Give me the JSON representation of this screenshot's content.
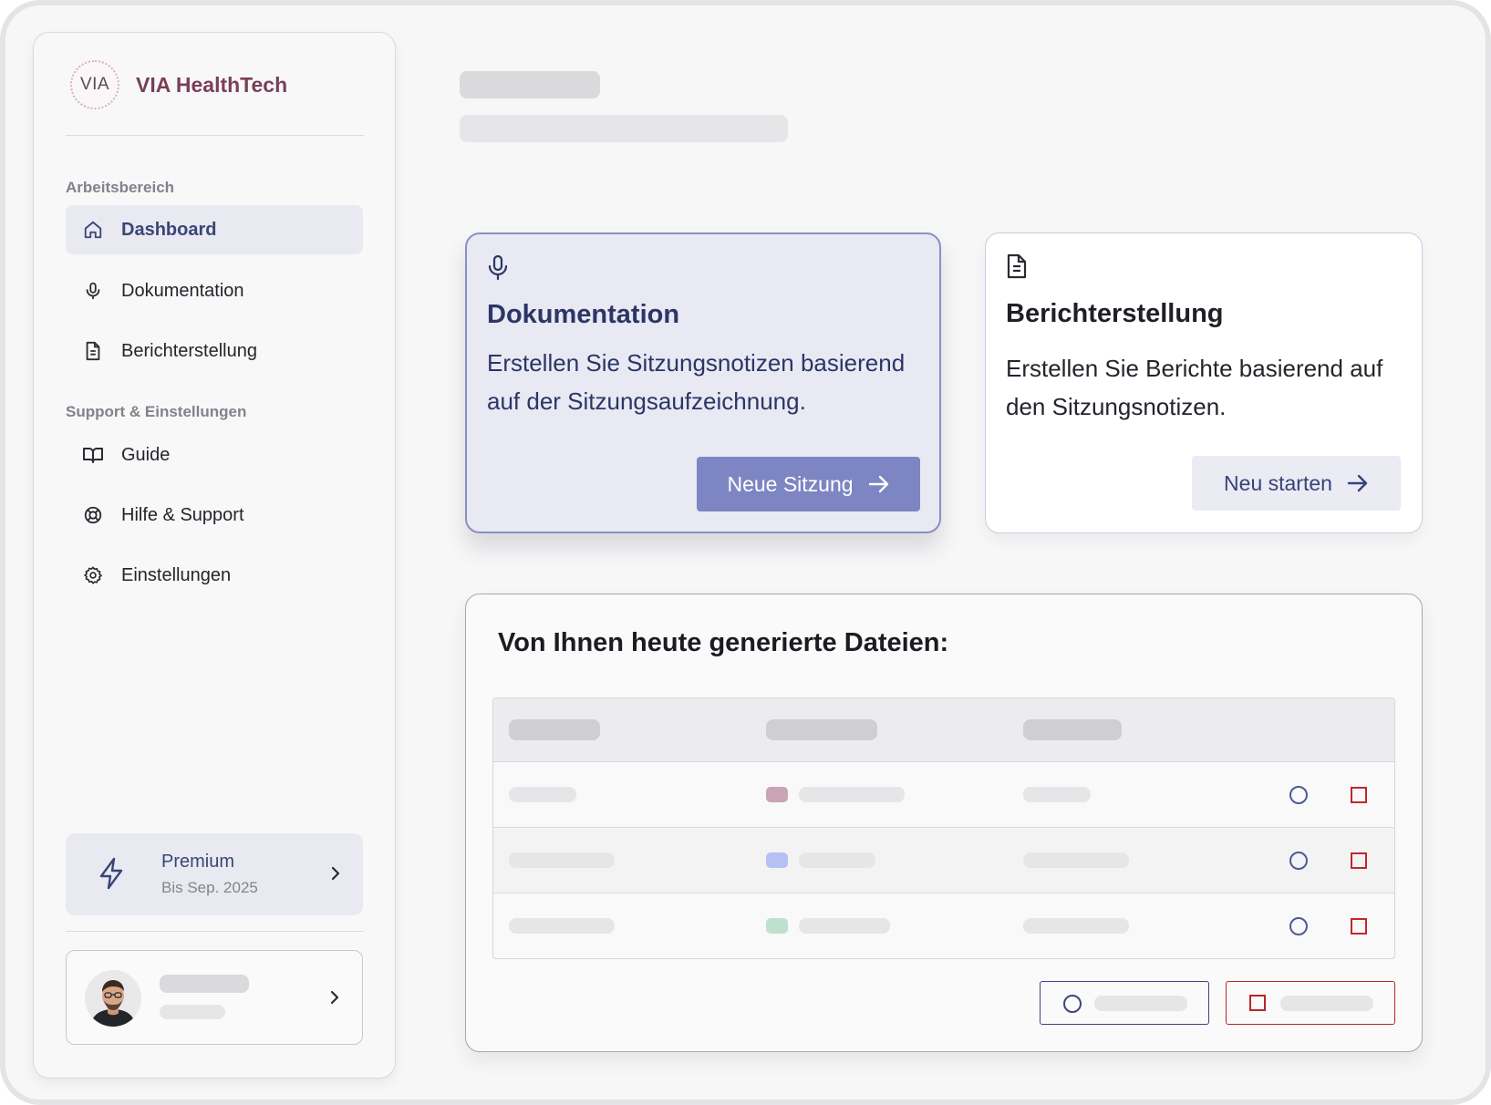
{
  "brand": {
    "logo_text": "VIA",
    "name": "VIA HealthTech"
  },
  "sidebar": {
    "section_workspace": "Arbeitsbereich",
    "section_support": "Support & Einstellungen",
    "items": [
      {
        "label": "Dashboard",
        "icon": "home-icon",
        "active": true
      },
      {
        "label": "Dokumentation",
        "icon": "microphone-icon",
        "active": false
      },
      {
        "label": "Berichterstellung",
        "icon": "document-icon",
        "active": false
      },
      {
        "label": "Guide",
        "icon": "book-icon",
        "active": false
      },
      {
        "label": "Hilfe & Support",
        "icon": "lifebuoy-icon",
        "active": false
      },
      {
        "label": "Einstellungen",
        "icon": "gear-icon",
        "active": false
      }
    ],
    "premium": {
      "title": "Premium",
      "subtitle": "Bis Sep. 2025",
      "icon": "lightning-icon"
    },
    "profile": {
      "icon": "avatar"
    }
  },
  "cards": {
    "documentation": {
      "title": "Dokumentation",
      "description": "Erstellen Sie Sitzungsnotizen basierend auf der Sitzungsaufzeichnung.",
      "button": "Neue Sitzung",
      "icon": "microphone-icon"
    },
    "reports": {
      "title": "Berichterstellung",
      "description": "Erstellen Sie Berichte basierend auf den Sitzungsnotizen.",
      "button": "Neu starten",
      "icon": "document-icon"
    }
  },
  "files": {
    "title": "Von Ihnen heute generierte Dateien:",
    "rows": [
      {
        "tag_color": "#c9a5b3"
      },
      {
        "tag_color": "#b4c1f2"
      },
      {
        "tag_color": "#bfe0cf"
      }
    ]
  },
  "colors": {
    "accent": "#7d85c2",
    "brand": "#7a3f58",
    "danger": "#b8262b",
    "navy": "#3b4577"
  }
}
